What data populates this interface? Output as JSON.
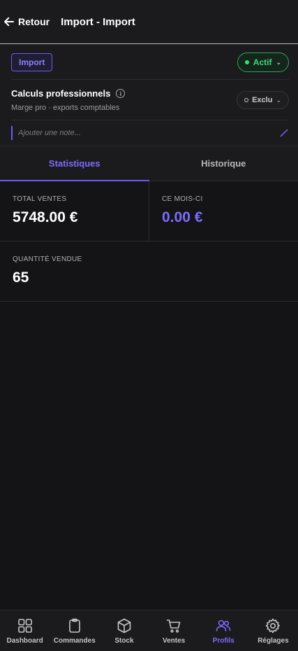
{
  "header": {
    "back_label": "Retour",
    "title": "Import - Import"
  },
  "profile": {
    "tag": "Import",
    "status": "Actif",
    "pro_title": "Calculs professionnels",
    "pro_subtitle": "Marge pro · exports comptables",
    "pro_mode": "Exclu",
    "note_placeholder": "Ajouter une note..."
  },
  "tabs": [
    {
      "label": "Statistiques",
      "active": true
    },
    {
      "label": "Historique",
      "active": false
    }
  ],
  "stats": {
    "total_ventes": {
      "label": "TOTAL VENTES",
      "value": "5748.00 €"
    },
    "ce_mois": {
      "label": "CE MOIS-CI",
      "value": "0.00 €"
    },
    "quantite": {
      "label": "QUANTITÉ VENDUE",
      "value": "65"
    }
  },
  "nav": [
    {
      "label": "Dashboard",
      "icon": "dashboard-icon"
    },
    {
      "label": "Commandes",
      "icon": "clipboard-icon"
    },
    {
      "label": "Stock",
      "icon": "box-icon"
    },
    {
      "label": "Ventes",
      "icon": "cart-icon"
    },
    {
      "label": "Profils",
      "icon": "users-icon",
      "active": true
    },
    {
      "label": "Réglages",
      "icon": "gear-icon"
    }
  ],
  "colors": {
    "accent": "#6b5cf0",
    "status_green": "#3ddc7a",
    "background": "#141416",
    "surface": "#1b1b1e"
  }
}
